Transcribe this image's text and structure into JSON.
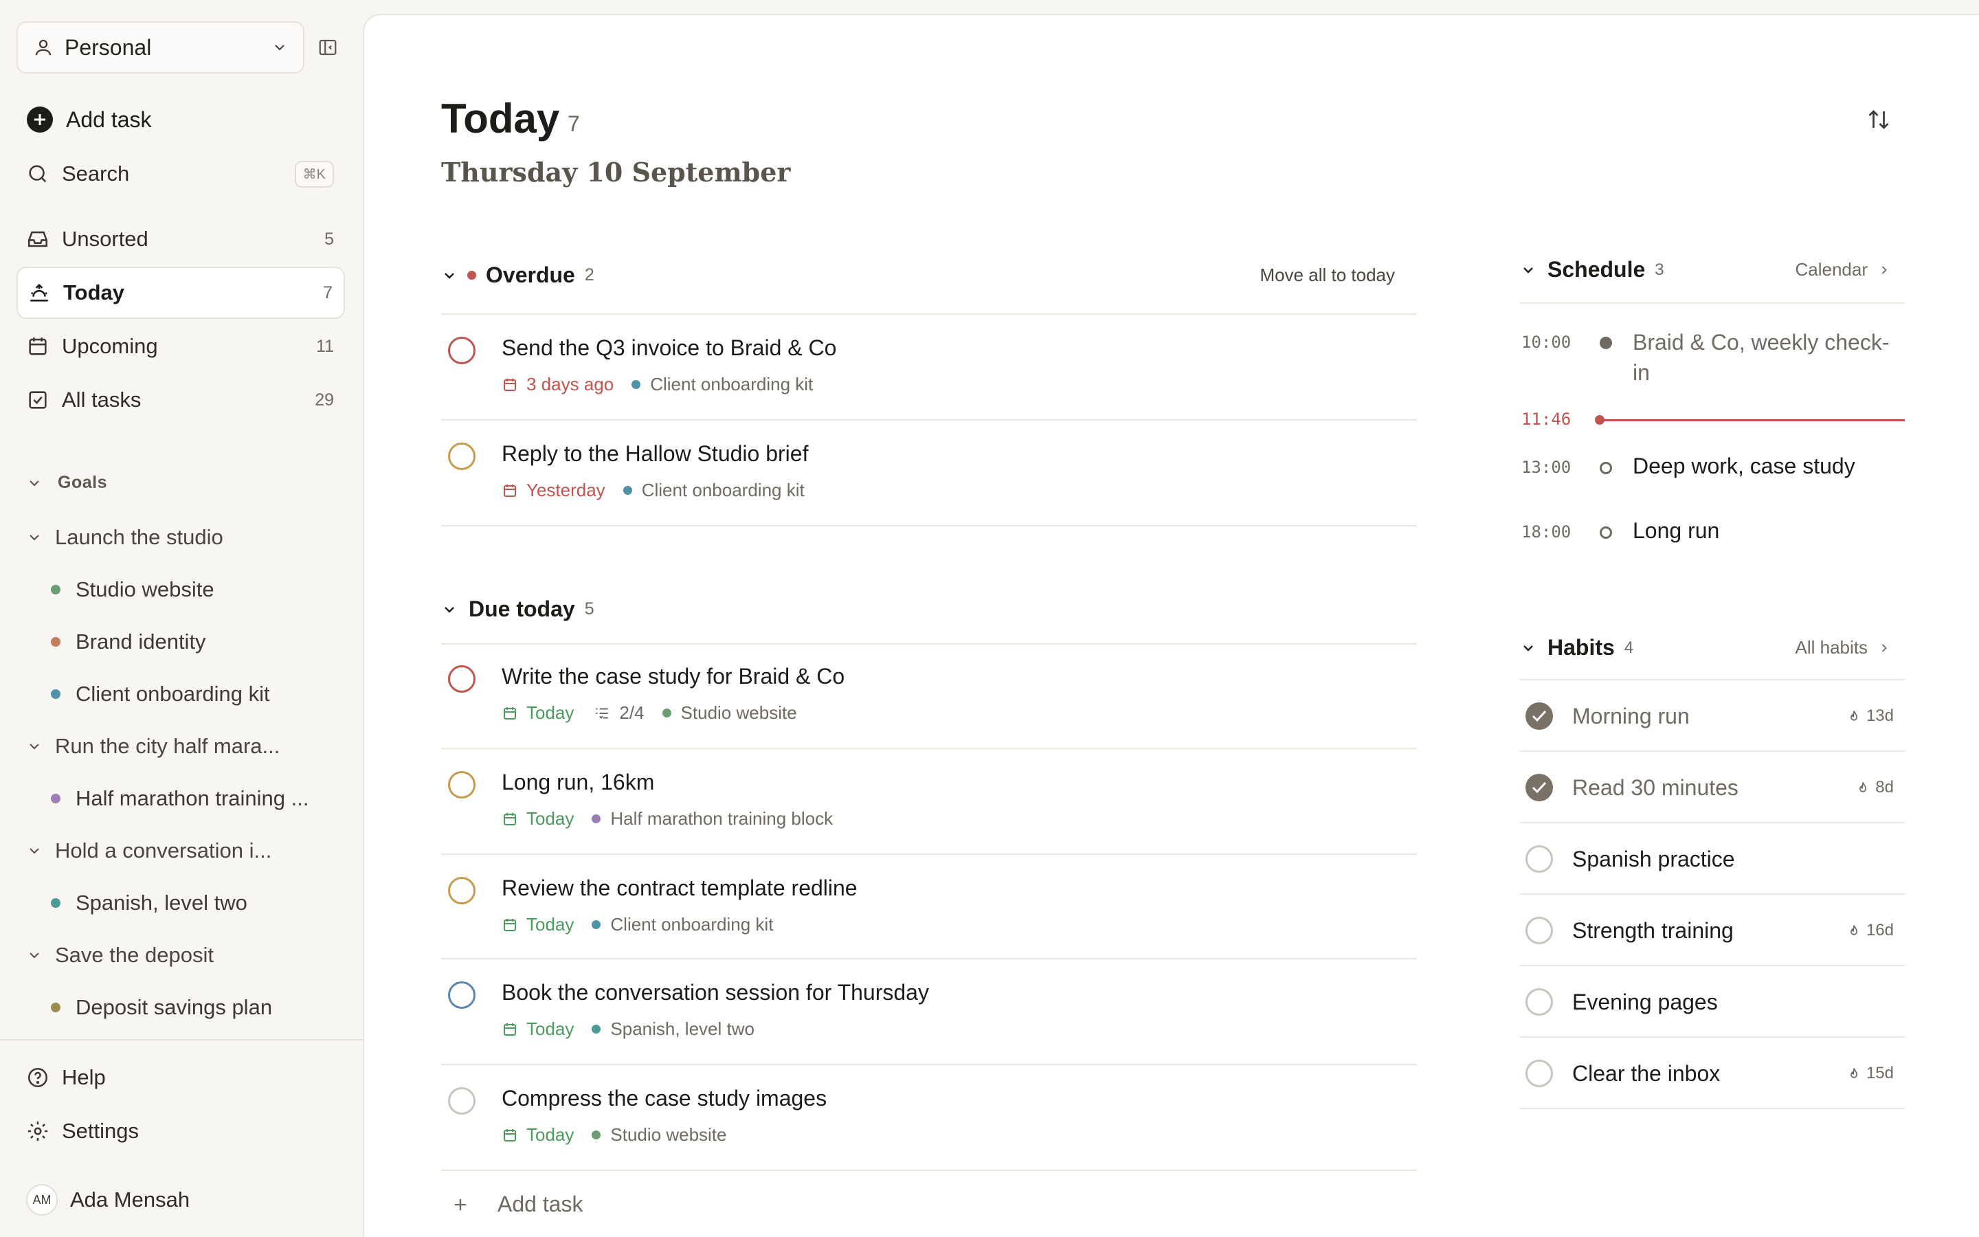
{
  "sidebar": {
    "workspace": "Personal",
    "add_task": "Add task",
    "search": "Search",
    "search_kbd": "⌘K",
    "nav": [
      {
        "label": "Unsorted",
        "count": "5"
      },
      {
        "label": "Today",
        "count": "7"
      },
      {
        "label": "Upcoming",
        "count": "11"
      },
      {
        "label": "All tasks",
        "count": "29"
      }
    ],
    "goals_label": "Goals",
    "goals": [
      {
        "label": "Launch the studio",
        "projects": [
          {
            "label": "Studio website",
            "color": "#6a9e72"
          },
          {
            "label": "Brand identity",
            "color": "#c27e5d"
          },
          {
            "label": "Client onboarding kit",
            "color": "#4f93a8"
          }
        ]
      },
      {
        "label": "Run the city half mara...",
        "projects": [
          {
            "label": "Half marathon training ...",
            "color": "#9b7fb5"
          }
        ]
      },
      {
        "label": "Hold a conversation i...",
        "projects": [
          {
            "label": "Spanish, level two",
            "color": "#4a9a96"
          }
        ]
      },
      {
        "label": "Save the deposit",
        "projects": [
          {
            "label": "Deposit savings plan",
            "color": "#9a8d4e"
          }
        ]
      }
    ],
    "help": "Help",
    "settings": "Settings",
    "user_initials": "AM",
    "user_name": "Ada Mensah"
  },
  "main": {
    "title": "Today",
    "count": "7",
    "date": "Thursday 10 September",
    "overdue": {
      "title": "Overdue",
      "count": "2",
      "action": "Move all to today",
      "tasks": [
        {
          "title": "Send the Q3 invoice to Braid & Co",
          "date": "3 days ago",
          "project": "Client onboarding kit"
        },
        {
          "title": "Reply to the Hallow Studio brief",
          "date": "Yesterday",
          "project": "Client onboarding kit"
        }
      ]
    },
    "due_today": {
      "title": "Due today",
      "count": "5",
      "tasks": [
        {
          "title": "Write the case study for Braid & Co",
          "date": "Today",
          "subtasks": "2/4",
          "project": "Studio website"
        },
        {
          "title": "Long run, 16km",
          "date": "Today",
          "project": "Half marathon training block"
        },
        {
          "title": "Review the contract template redline",
          "date": "Today",
          "project": "Client onboarding kit"
        },
        {
          "title": "Book the conversation session for Thursday",
          "date": "Today",
          "project": "Spanish, level two"
        },
        {
          "title": "Compress the case study images",
          "date": "Today",
          "project": "Studio website"
        }
      ]
    },
    "add_task": "Add task"
  },
  "schedule": {
    "title": "Schedule",
    "count": "3",
    "link": "Calendar",
    "now": "11:46",
    "events": [
      {
        "time": "10:00",
        "title": "Braid & Co, weekly check-in"
      },
      {
        "time": "13:00",
        "title": "Deep work, case study"
      },
      {
        "time": "18:00",
        "title": "Long run"
      }
    ]
  },
  "habits": {
    "title": "Habits",
    "count": "4",
    "link": "All habits",
    "items": [
      {
        "name": "Morning run",
        "done": true,
        "streak": "13d"
      },
      {
        "name": "Read 30 minutes",
        "done": true,
        "streak": "8d"
      },
      {
        "name": "Spanish practice",
        "done": false,
        "streak": ""
      },
      {
        "name": "Strength training",
        "done": false,
        "streak": "16d"
      },
      {
        "name": "Evening pages",
        "done": false,
        "streak": ""
      },
      {
        "name": "Clear the inbox",
        "done": false,
        "streak": "15d"
      }
    ]
  },
  "colors": {
    "overdue_red": "#c0544f",
    "today_green": "#4e9a5e",
    "priority_high": "#c0544f",
    "priority_medium": "#c99a4e",
    "priority_low": "#5a86b0",
    "priority_none": "#c9c5bd"
  }
}
